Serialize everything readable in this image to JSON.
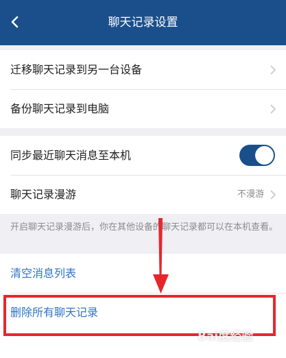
{
  "header": {
    "title": "聊天记录设置",
    "back_icon": "chevron-left-icon"
  },
  "group1": {
    "items": [
      {
        "label": "迁移聊天记录到另一台设备"
      },
      {
        "label": "备份聊天记录到电脑"
      }
    ]
  },
  "group2": {
    "sync_label": "同步最近聊天消息至本机",
    "sync_enabled": true,
    "roam_label": "聊天记录漫游",
    "roam_value": "不漫游"
  },
  "tip": "开启聊天记录漫游后，你在其他设备的聊天记录都可以在本机查看。",
  "group3": {
    "clear_label": "清空消息列表",
    "delete_label": "删除所有聊天记录"
  },
  "annotation": {
    "highlight_color": "#e6262d"
  },
  "watermark": "Bai度经验",
  "colors": {
    "header_bg": "#1b4f8c",
    "link": "#2f73c6",
    "toggle_on": "#1b4f8c"
  }
}
